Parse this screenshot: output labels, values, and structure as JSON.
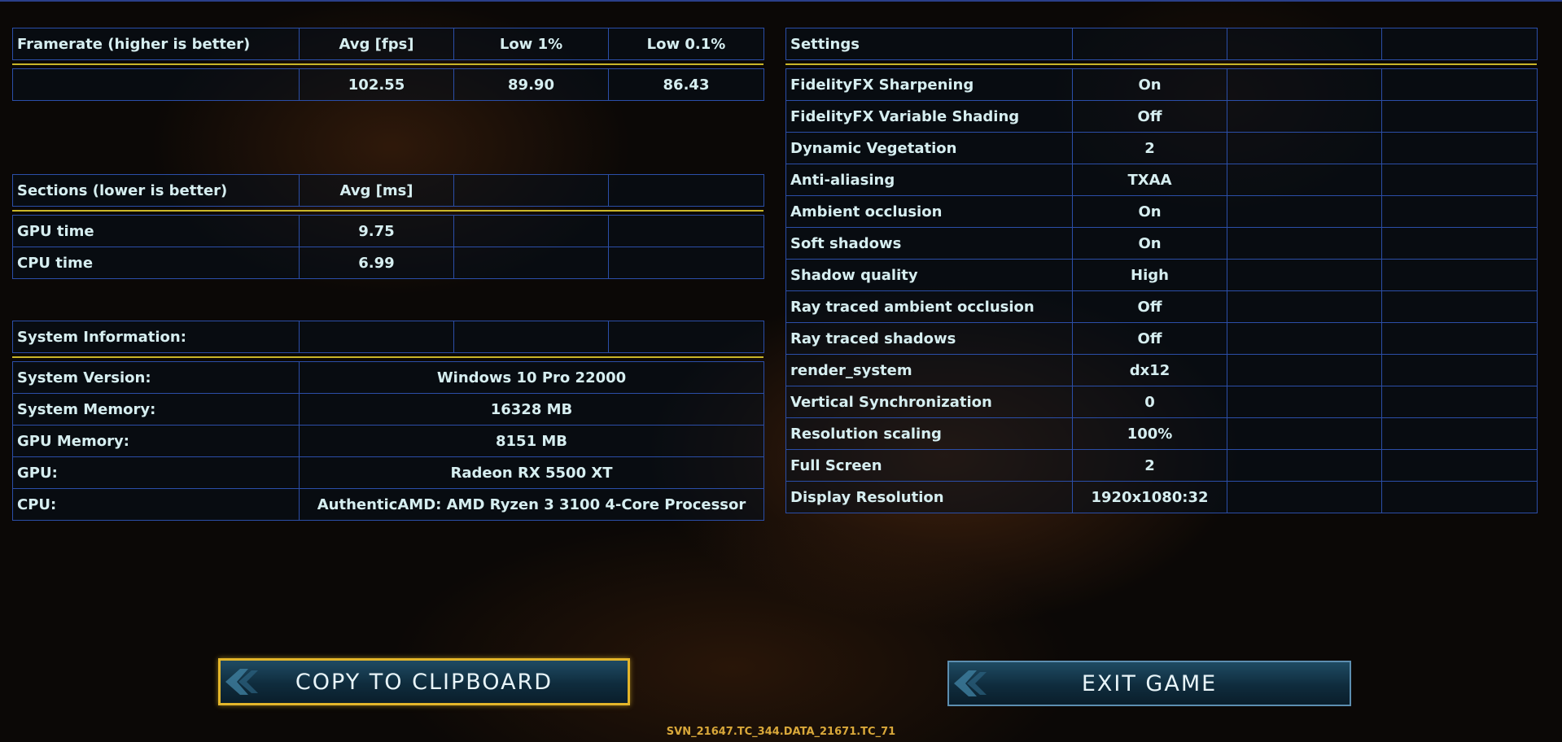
{
  "framerate": {
    "headers": [
      "Framerate (higher is better)",
      "Avg [fps]",
      "Low 1%",
      "Low 0.1%"
    ],
    "row": [
      "",
      "102.55",
      "89.90",
      "86.43"
    ]
  },
  "sections": {
    "headers": [
      "Sections (lower is better)",
      "Avg [ms]",
      "",
      ""
    ],
    "rows": [
      [
        "GPU time",
        "9.75",
        "",
        ""
      ],
      [
        "CPU time",
        "6.99",
        "",
        ""
      ]
    ]
  },
  "system": {
    "header": "System Information:",
    "rows": [
      [
        "System Version:",
        "Windows 10 Pro 22000"
      ],
      [
        "System Memory:",
        "16328 MB"
      ],
      [
        "GPU Memory:",
        "8151 MB"
      ],
      [
        "GPU:",
        "Radeon RX 5500 XT"
      ],
      [
        "CPU:",
        "AuthenticAMD: AMD Ryzen 3 3100 4-Core Processor"
      ]
    ]
  },
  "settings": {
    "header": "Settings",
    "rows": [
      [
        "FidelityFX Sharpening",
        "On"
      ],
      [
        "FidelityFX Variable Shading",
        "Off"
      ],
      [
        "Dynamic Vegetation",
        "2"
      ],
      [
        "Anti-aliasing",
        "TXAA"
      ],
      [
        "Ambient occlusion",
        "On"
      ],
      [
        "Soft shadows",
        "On"
      ],
      [
        "Shadow quality",
        "High"
      ],
      [
        "Ray traced ambient occlusion",
        "Off"
      ],
      [
        "Ray traced shadows",
        "Off"
      ],
      [
        "render_system",
        "dx12"
      ],
      [
        "Vertical Synchronization",
        "0"
      ],
      [
        "Resolution scaling",
        "100%"
      ],
      [
        "Full Screen",
        "2"
      ],
      [
        "Display Resolution",
        "1920x1080:32"
      ]
    ]
  },
  "buttons": {
    "copy_label": "COPY TO CLIPBOARD",
    "exit_label": "EXIT GAME"
  },
  "version": "SVN_21647.TC_344.DATA_21671.TC_71",
  "colors": {
    "accent_line": "#c9b62a",
    "table_border": "#2b4ea8",
    "copy_button_border": "#e3b52a",
    "version_text": "#d9a83a"
  }
}
